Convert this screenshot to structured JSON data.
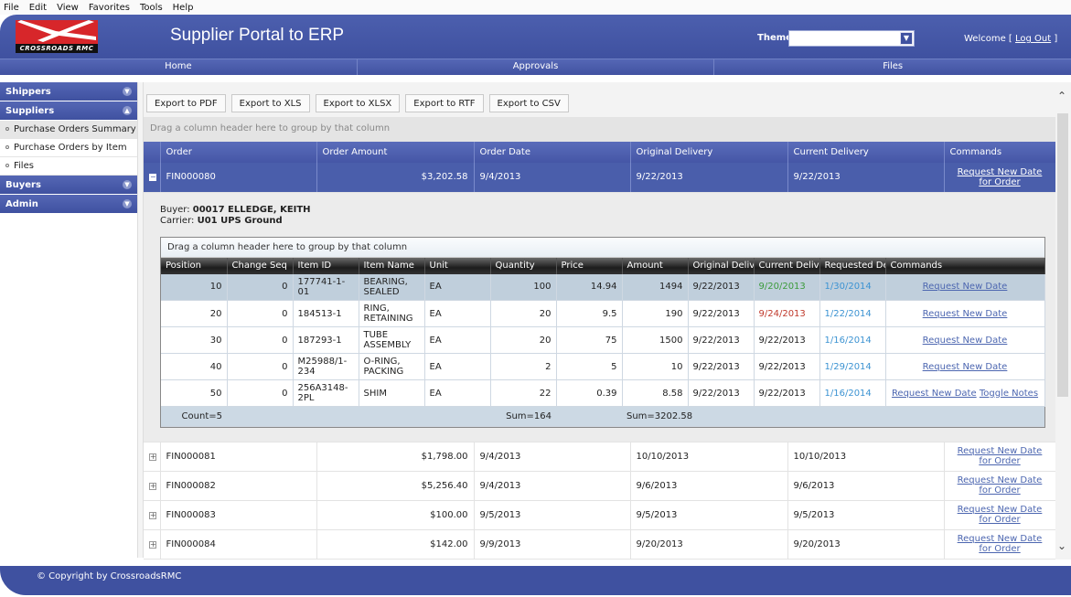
{
  "menubar": [
    "File",
    "Edit",
    "View",
    "Favorites",
    "Tools",
    "Help"
  ],
  "header": {
    "logo_text": "CROSSROADS RMC",
    "title": "Supplier Portal to ERP",
    "theme_label": "Theme",
    "theme_value": "",
    "welcome": "Welcome",
    "logout": "Log Out"
  },
  "nav": [
    "Home",
    "Approvals",
    "Files"
  ],
  "sidebar": {
    "groups": [
      {
        "label": "Shippers",
        "expanded": false
      },
      {
        "label": "Suppliers",
        "expanded": true,
        "items": [
          "Purchase Orders Summary",
          "Purchase Orders by Item",
          "Files"
        ],
        "active": "Purchase Orders Summary"
      },
      {
        "label": "Buyers",
        "expanded": false
      },
      {
        "label": "Admin",
        "expanded": false
      }
    ]
  },
  "toolbar": [
    "Export to PDF",
    "Export to XLS",
    "Export to XLSX",
    "Export to RTF",
    "Export to CSV"
  ],
  "group_panel": "Drag a column header here to group by that column",
  "grid": {
    "columns": [
      "Order",
      "Order Amount",
      "Order Date",
      "Original Delivery",
      "Current Delivery",
      "Commands"
    ],
    "command_label": "Request New Date for Order",
    "rows": [
      {
        "order": "FIN000080",
        "amount": "$3,202.58",
        "order_date": "9/4/2013",
        "original": "9/22/2013",
        "current": "9/22/2013",
        "expanded": true
      },
      {
        "order": "FIN000081",
        "amount": "$1,798.00",
        "order_date": "9/4/2013",
        "original": "10/10/2013",
        "current": "10/10/2013"
      },
      {
        "order": "FIN000082",
        "amount": "$5,256.40",
        "order_date": "9/4/2013",
        "original": "9/6/2013",
        "current": "9/6/2013"
      },
      {
        "order": "FIN000083",
        "amount": "$100.00",
        "order_date": "9/5/2013",
        "original": "9/5/2013",
        "current": "9/5/2013"
      },
      {
        "order": "FIN000084",
        "amount": "$142.00",
        "order_date": "9/9/2013",
        "original": "9/20/2013",
        "current": "9/20/2013"
      }
    ]
  },
  "detail": {
    "buyer_label": "Buyer:",
    "buyer": "00017 ELLEDGE, KEITH",
    "carrier_label": "Carrier:",
    "carrier": "U01 UPS Ground",
    "group_panel": "Drag a column header here to group by that column",
    "columns": [
      "Position",
      "Change Seq",
      "Item ID",
      "Item Name",
      "Unit",
      "Quantity",
      "Price",
      "Amount",
      "Original Deliver",
      "Current Deliver",
      "Requested Deli",
      "Commands"
    ],
    "rows": [
      {
        "position": "10",
        "seq": "0",
        "item_id": "177741-1-01",
        "item_name": "BEARING, SEALED",
        "unit": "EA",
        "qty": "100",
        "price": "14.94",
        "amount": "1494",
        "original": "9/22/2013",
        "current": "9/20/2013",
        "current_status": "early",
        "requested": "1/30/2014",
        "commands": [
          "Request New Date"
        ]
      },
      {
        "position": "20",
        "seq": "0",
        "item_id": "184513-1",
        "item_name": "RING, RETAINING",
        "unit": "EA",
        "qty": "20",
        "price": "9.5",
        "amount": "190",
        "original": "9/22/2013",
        "current": "9/24/2013",
        "current_status": "late",
        "requested": "1/22/2014",
        "commands": [
          "Request New Date"
        ]
      },
      {
        "position": "30",
        "seq": "0",
        "item_id": "187293-1",
        "item_name": "TUBE ASSEMBLY",
        "unit": "EA",
        "qty": "20",
        "price": "75",
        "amount": "1500",
        "original": "9/22/2013",
        "current": "9/22/2013",
        "current_status": "normal",
        "requested": "1/16/2014",
        "commands": [
          "Request New Date"
        ]
      },
      {
        "position": "40",
        "seq": "0",
        "item_id": "M25988/1-234",
        "item_name": "O-RING, PACKING",
        "unit": "EA",
        "qty": "2",
        "price": "5",
        "amount": "10",
        "original": "9/22/2013",
        "current": "9/22/2013",
        "current_status": "normal",
        "requested": "1/29/2014",
        "commands": [
          "Request New Date"
        ]
      },
      {
        "position": "50",
        "seq": "0",
        "item_id": "256A3148-2PL",
        "item_name": "SHIM",
        "unit": "EA",
        "qty": "22",
        "price": "0.39",
        "amount": "8.58",
        "original": "9/22/2013",
        "current": "9/22/2013",
        "current_status": "normal",
        "requested": "1/16/2014",
        "commands": [
          "Request New Date",
          "Toggle Notes"
        ]
      }
    ],
    "footer": {
      "count": "Count=5",
      "qty_sum": "Sum=164",
      "amount_sum": "Sum=3202.58"
    }
  },
  "colors": {
    "brand": "#3f51a0",
    "early": "#3c9b3c",
    "late": "#c0392b",
    "requested": "#3c93d2"
  },
  "footer": "© Copyright by CrossroadsRMC"
}
